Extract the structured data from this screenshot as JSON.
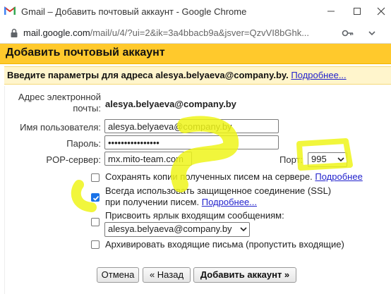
{
  "window": {
    "title": "Gmail – Добавить почтовый аккаунт - Google Chrome",
    "url_host": "mail.google.com",
    "url_path": "/mail/u/4/?ui=2&ik=3a4bbacb9a&jsver=QzvVI8bGhk..."
  },
  "dialog": {
    "title": "Добавить почтовый аккаунт",
    "subtitle": "Введите параметры для адреса alesya.belyaeva@company.by.",
    "subtitle_link": "Подробнее..."
  },
  "form": {
    "email_label": "Адрес электронной почты:",
    "email_value": "alesya.belyaeva@company.by",
    "username_label": "Имя пользователя:",
    "username_value": "alesya.belyaeva@company.by",
    "password_label": "Пароль:",
    "password_value": "••••••••••••••••",
    "pop_label": "POP-сервер:",
    "pop_value": "mx.mito-team.com",
    "port_label": "Порт:",
    "port_value": "995"
  },
  "options": {
    "keep_copy_label": "Сохранять копии полученных писем на сервере.",
    "keep_copy_link": "Подробнее",
    "keep_copy_checked": false,
    "ssl_label": "Всегда использовать защищенное соединение (SSL) при получении писем.",
    "ssl_link": "Подробнее...",
    "ssl_checked": true,
    "label_label": "Присвоить ярлык входящим сообщениям:",
    "label_value": "alesya.belyaeva@company.by",
    "label_checked": false,
    "archive_label": "Архивировать входящие письма (пропустить входящие)",
    "archive_checked": false
  },
  "buttons": {
    "cancel": "Отмена",
    "back": "« Назад",
    "add": "Добавить аккаунт »"
  },
  "colors": {
    "header_bg": "#ffc92c",
    "highlighter": "#eef51a",
    "link": "#2222cc",
    "checkbox_checked": "#1a73e8"
  }
}
